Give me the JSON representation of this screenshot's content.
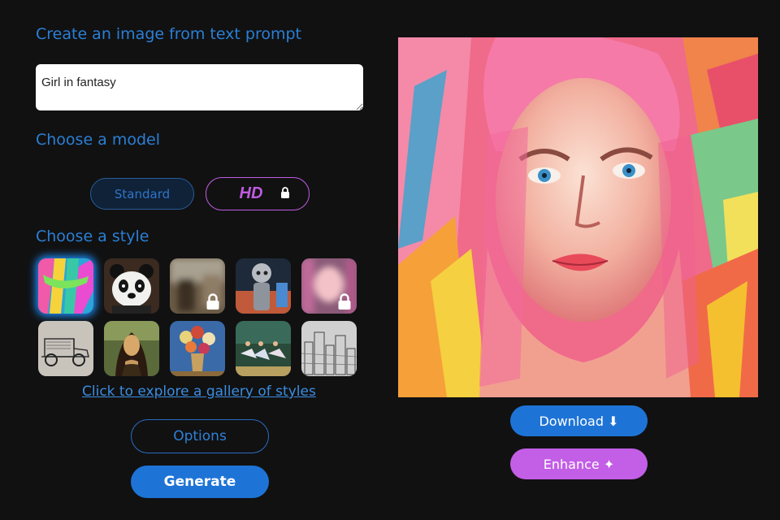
{
  "headings": {
    "create": "Create an image from text prompt",
    "model": "Choose a model",
    "style": "Choose a style"
  },
  "prompt": {
    "value": "Girl in fantasy"
  },
  "models": {
    "standard_label": "Standard",
    "hd_label": "HD",
    "hd_locked": true,
    "selected": "Standard"
  },
  "styles": [
    {
      "name": "abstract-paint",
      "locked": false,
      "selected": true
    },
    {
      "name": "panda",
      "locked": false,
      "selected": false
    },
    {
      "name": "blurred-photo",
      "locked": true,
      "selected": false
    },
    {
      "name": "robot",
      "locked": false,
      "selected": false
    },
    {
      "name": "blurred-portrait",
      "locked": true,
      "selected": false
    },
    {
      "name": "vintage-car-sketch",
      "locked": false,
      "selected": false
    },
    {
      "name": "mona-lisa",
      "locked": false,
      "selected": false
    },
    {
      "name": "flower-vase",
      "locked": false,
      "selected": false
    },
    {
      "name": "ballerinas",
      "locked": false,
      "selected": false
    },
    {
      "name": "city-sketch",
      "locked": false,
      "selected": false
    }
  ],
  "gallery_link": "Click to explore a gallery of styles",
  "buttons": {
    "options": "Options",
    "generate": "Generate",
    "download": "Download ⬇",
    "enhance": "Enhance ✦"
  },
  "colors": {
    "background": "#111112",
    "accent_blue": "#1e74d6",
    "accent_purple": "#c35ee6"
  }
}
